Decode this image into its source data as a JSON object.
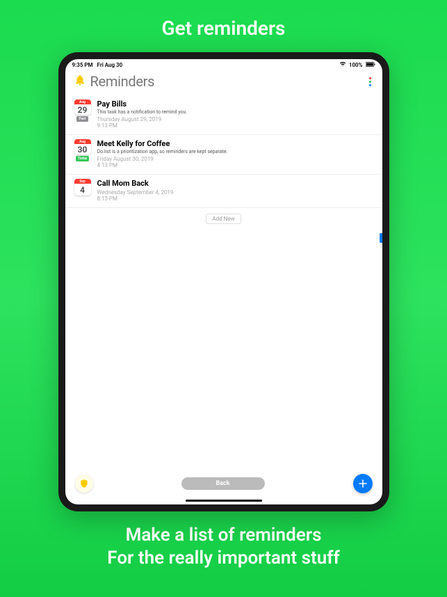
{
  "promo": {
    "top": "Get reminders",
    "bottom_line1": "Make a list of reminders",
    "bottom_line2": "For the really important stuff"
  },
  "status": {
    "time": "9:35 PM",
    "date": "Fri Aug 30",
    "wifi": "⬤",
    "battery_pct": "100%"
  },
  "header": {
    "title": "Reminders"
  },
  "reminders": [
    {
      "month": "Aug",
      "day": "29",
      "badge": "Past",
      "badge_color": "#8e8e93",
      "title": "Pay Bills",
      "desc": "This task has a notification to remind you.",
      "date": "Thursday August 29, 2019",
      "time": "9:13 PM"
    },
    {
      "month": "Aug",
      "day": "30",
      "badge": "Today",
      "badge_color": "#34c759",
      "title": "Meet Kelly for Coffee",
      "desc": "Do.list is a prioritization app, so reminders are kept separate.",
      "date": "Friday August 30, 2019",
      "time": "4:13 PM"
    },
    {
      "month": "Sep",
      "day": "4",
      "badge": "",
      "badge_color": "",
      "title": "Call Mom Back",
      "desc": "",
      "date": "Wednesday September 4, 2019",
      "time": "8:13 PM"
    }
  ],
  "buttons": {
    "add_new": "Add New",
    "back": "Back"
  },
  "colors": {
    "accent_blue": "#007aff",
    "accent_green": "#34c759",
    "accent_red": "#ff3b30",
    "bell_yellow": "#ffcc00"
  },
  "more_dots": [
    "#ff3b30",
    "#34c759",
    "#007aff"
  ]
}
